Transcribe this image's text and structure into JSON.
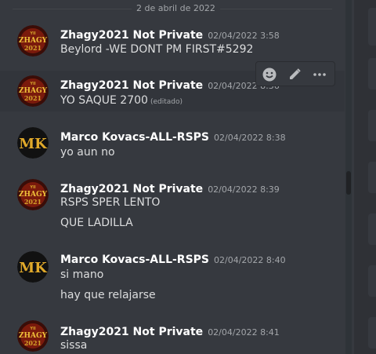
{
  "date_divider": "2 de abril de 2022",
  "messages": [
    {
      "author": "Zhagy2021 Not Private",
      "time": "02/04/2022 3:58",
      "lines": [
        "Beylord  -WE DONT PM FIRST#5292"
      ]
    },
    {
      "author": "Zhagy2021 Not Private",
      "time": "02/04/2022 8:36",
      "lines": [
        "YO SAQUE 2700"
      ],
      "edited": "(editado)"
    },
    {
      "author": "Marco Kovacs-ALL-RSPS",
      "time": "02/04/2022 8:38",
      "lines": [
        "yo aun no"
      ]
    },
    {
      "author": "Zhagy2021 Not Private",
      "time": "02/04/2022 8:39",
      "lines": [
        "RSPS SPER LENTO",
        "QUE LADILLA"
      ]
    },
    {
      "author": "Marco Kovacs-ALL-RSPS",
      "time": "02/04/2022 8:40",
      "lines": [
        "si mano",
        "hay que relajarse"
      ]
    },
    {
      "author": "Zhagy2021 Not Private",
      "time": "02/04/2022 8:41",
      "lines": [
        "sissa"
      ]
    }
  ],
  "avatars": {
    "zhagy": {
      "icon": "zhagy-avatar",
      "text_top": "YII",
      "text_mid": "ZHAGY",
      "text_bottom": "2021",
      "color": "#d4a12a"
    },
    "marco": {
      "icon": "mk-dragon-avatar",
      "text": "MK",
      "color": "#e0a92a"
    }
  },
  "toolbar": {
    "icons": [
      "add-reaction-icon",
      "edit-icon",
      "more-icon"
    ]
  },
  "colors": {
    "background": "#36393f",
    "username": "#ffffff",
    "timestamp": "#a3a6aa",
    "text": "#dcddde"
  }
}
